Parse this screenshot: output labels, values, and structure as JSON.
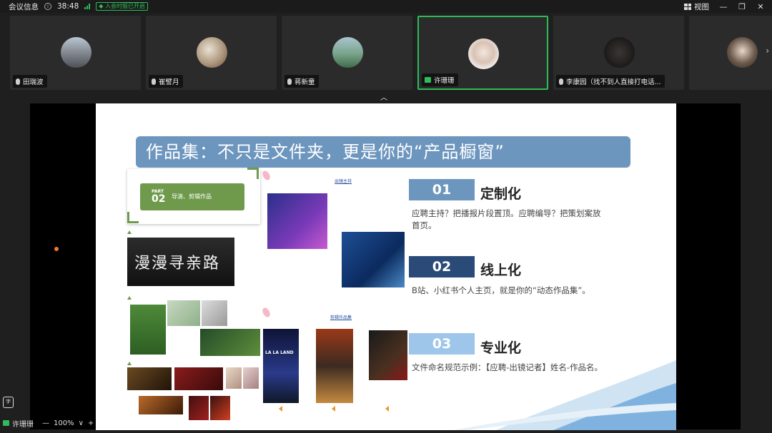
{
  "topbar": {
    "meeting_info": "会议信息",
    "timer": "38:48",
    "rec_badge": "入会时报已开启",
    "view_label": "视图",
    "minimize_glyph": "—",
    "restore_glyph": "❐",
    "close_glyph": "✕"
  },
  "participants": [
    {
      "name": "田瑞波",
      "icon": "mic-icon"
    },
    {
      "name": "崔譬月",
      "icon": "mic-icon"
    },
    {
      "name": "蒋新童",
      "icon": "mic-icon"
    },
    {
      "name": "许珊珊",
      "icon": "screen-share-icon",
      "active": true
    },
    {
      "name": "李康园（找不到人直接打电话...",
      "icon": "mic-icon"
    },
    {
      "name": "",
      "icon": "mic-icon"
    }
  ],
  "tiles_next_glyph": "›",
  "collapse_glyph": "︿",
  "slide": {
    "title": "作品集：不只是文件夹，更是你的“产品橱窗”",
    "card": {
      "part": "PART",
      "num": "02",
      "title": "导演、剪辑作品"
    },
    "calligraphy": "漫漫寻亲路",
    "poster_text": "LA LA LAND",
    "link_top": "出镜主持",
    "link_mid": "剪辑作品集",
    "sections": [
      {
        "num": "01",
        "title": "定制化",
        "desc": "应聘主持？把播报片段置顶。应聘编导？把策划案放首页。",
        "color": "#6d96be"
      },
      {
        "num": "02",
        "title": "线上化",
        "desc": "B站、小红书个人主页，就是你的“动态作品集”。",
        "color": "#2a4a78"
      },
      {
        "num": "03",
        "title": "专业化",
        "desc": "文件命名规范示例：【应聘-出镜记者】姓名-作品名。",
        "color": "#9dc6ea"
      }
    ]
  },
  "bottombar": {
    "presenter": "许珊珊",
    "zoom_minus": "—",
    "zoom": "100%",
    "zoom_chevron": "∨",
    "zoom_plus": "+"
  },
  "colors": {
    "accent_green": "#2ebd59",
    "banner_blue": "#6d96be",
    "card_green": "#6f9a4c"
  }
}
